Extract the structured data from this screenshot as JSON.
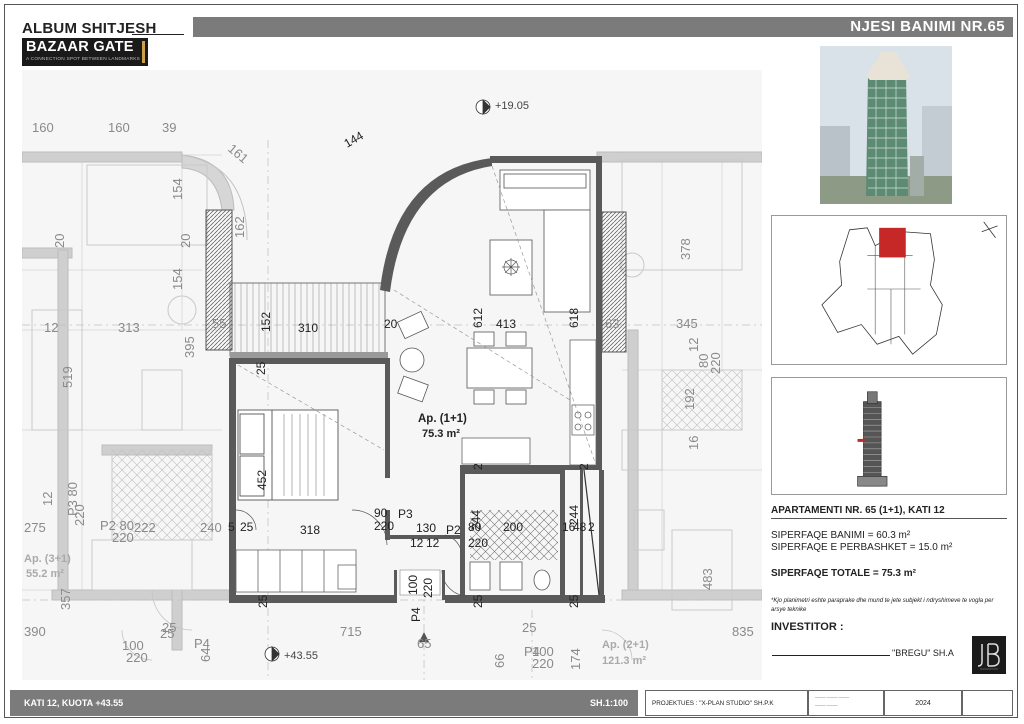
{
  "header": {
    "album": "ALBUM SHITJESH",
    "logo_name": "BAZAAR GATE",
    "logo_tagline": "A CONNECTION SPOT BETWEEN LANDMARKS",
    "unit_title": "NJESI BANIMI NR.65"
  },
  "plan": {
    "level_marks": [
      "+19.05",
      "+43.55"
    ],
    "apartment_label": "Ap. (1+1)",
    "apartment_area": "75.3 m²",
    "neighbour_left_label": "Ap. (3+1)",
    "neighbour_left_area": "55.2 m²",
    "neighbour_right_label": "Ap. (2+1)",
    "neighbour_right_area": "121.3 m²",
    "dims_gray": [
      "160",
      "160",
      "39",
      "161",
      "154",
      "154",
      "20",
      "20",
      "162",
      "12",
      "313",
      "395",
      "55",
      "519",
      "275",
      "222",
      "240",
      "12",
      "P3 80",
      "220",
      "P2 80",
      "220",
      "390",
      "357",
      "715",
      "835",
      "63",
      "345",
      "378",
      "12",
      "80",
      "220",
      "192",
      "16",
      "483",
      "25",
      "25",
      "25",
      "100",
      "220",
      "P4",
      "64",
      "66",
      "P4",
      "100",
      "220",
      "174",
      "65"
    ],
    "dims_dark": [
      "144",
      "152",
      "310",
      "20",
      "612",
      "413",
      "618",
      "25",
      "452",
      "318",
      "90",
      "220",
      "P3",
      "130",
      "P2",
      "80",
      "220",
      "12",
      "12",
      "244",
      "200",
      "16",
      "48",
      "2",
      "244",
      "2",
      "2",
      "25",
      "25",
      "25",
      "100",
      "220",
      "P4",
      "25",
      "5"
    ]
  },
  "details": {
    "apartment_title": "APARTAMENTI NR. 65 (1+1), KATI 12",
    "area_living": "SIPERFAQE BANIMI = 60.3 m²",
    "area_shared": "SIPERFAQE E PERBASHKET = 15.0 m²",
    "area_total": "SIPERFAQE TOTALE = 75.3 m²",
    "note": "*Kjo planimetri eshte paraprake dhe mund te jete subjekt i ndryshimeve te vogla per arsye teknike",
    "investor_label": "INVESTITOR :",
    "investor_name": "\"BREGU\" SH.A"
  },
  "footer": {
    "floor": "KATI 12, KUOTA +43.55",
    "scale": "SH.1:100",
    "designer": "PROJEKTUES : \"X-PLAN STUDIO\" SH.P.K",
    "year": "2024"
  },
  "colors": {
    "header_bar": "#7b7b7b",
    "wall": "#555555",
    "highlight_unit": "#c62828"
  }
}
